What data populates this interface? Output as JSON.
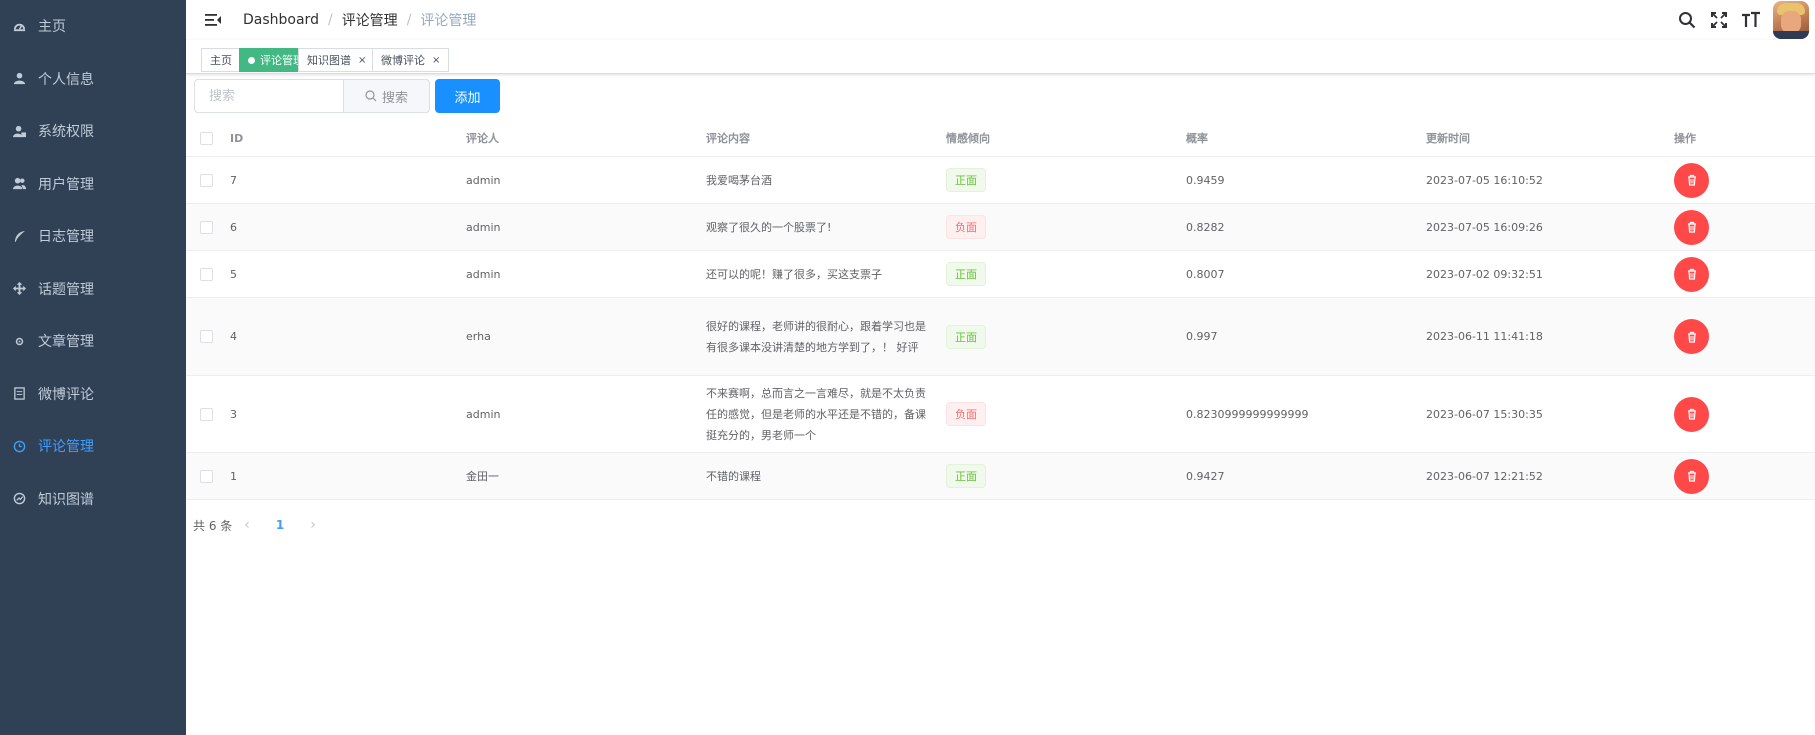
{
  "sidebar": {
    "items": [
      {
        "label": "主页",
        "icon": "dashboard-icon",
        "active": false
      },
      {
        "label": "个人信息",
        "icon": "user-icon",
        "active": false
      },
      {
        "label": "系统权限",
        "icon": "user-lock-icon",
        "active": false
      },
      {
        "label": "用户管理",
        "icon": "users-icon",
        "active": false
      },
      {
        "label": "日志管理",
        "icon": "feather-icon",
        "active": false
      },
      {
        "label": "话题管理",
        "icon": "move-icon",
        "active": false
      },
      {
        "label": "文章管理",
        "icon": "settings-icon",
        "active": false
      },
      {
        "label": "微博评论",
        "icon": "document-icon",
        "active": false
      },
      {
        "label": "评论管理",
        "icon": "clock-icon",
        "active": true
      },
      {
        "label": "知识图谱",
        "icon": "chart-icon",
        "active": false
      }
    ]
  },
  "navbar": {
    "breadcrumb": [
      "Dashboard",
      "评论管理",
      "评论管理"
    ],
    "separator": "/"
  },
  "tags": [
    {
      "label": "主页",
      "active": false,
      "closable": false
    },
    {
      "label": "评论管理",
      "active": true,
      "closable": true
    },
    {
      "label": "知识图谱",
      "active": false,
      "closable": true
    },
    {
      "label": "微博评论",
      "active": false,
      "closable": true
    }
  ],
  "tag_close": "×",
  "toolbar": {
    "search_placeholder": "搜索",
    "search_value": "",
    "search_button": "搜索",
    "add_button": "添加"
  },
  "table": {
    "headers": {
      "id": "ID",
      "user": "评论人",
      "content": "评论内容",
      "sentiment": "情感倾向",
      "probability": "概率",
      "updated": "更新时间",
      "operation": "操作"
    },
    "rows": [
      {
        "id": "7",
        "user": "admin",
        "content": "我爱喝茅台酒",
        "sentiment": "正面",
        "sentiment_type": "pos",
        "probability": "0.9459",
        "updated": "2023-07-05 16:10:52"
      },
      {
        "id": "6",
        "user": "admin",
        "content": "观察了很久的一个股票了!",
        "sentiment": "负面",
        "sentiment_type": "neg",
        "probability": "0.8282",
        "updated": "2023-07-05 16:09:26"
      },
      {
        "id": "5",
        "user": "admin",
        "content": "还可以的呢！赚了很多，买这支票子",
        "sentiment": "正面",
        "sentiment_type": "pos",
        "probability": "0.8007",
        "updated": "2023-07-02 09:32:51"
      },
      {
        "id": "4",
        "user": "erha",
        "content": "很好的课程，老师讲的很耐心，跟着学习也是有很多课本没讲清楚的地方学到了，！ 好评",
        "sentiment": "正面",
        "sentiment_type": "pos",
        "probability": "0.997",
        "updated": "2023-06-11 11:41:18"
      },
      {
        "id": "3",
        "user": "admin",
        "content": "不来赛啊，总而言之一言难尽，就是不太负责任的感觉，但是老师的水平还是不错的，备课挺充分的，男老师一个",
        "sentiment": "负面",
        "sentiment_type": "neg",
        "probability": "0.8230999999999999",
        "updated": "2023-06-07 15:30:35"
      },
      {
        "id": "1",
        "user": "金田一",
        "content": "不错的课程",
        "sentiment": "正面",
        "sentiment_type": "pos",
        "probability": "0.9427",
        "updated": "2023-06-07 12:21:52"
      }
    ]
  },
  "pagination": {
    "total_text": "共 6 条",
    "prev": "‹",
    "next": "›",
    "current_page": "1"
  },
  "colors": {
    "sidebar_bg": "#304156",
    "accent": "#409eff",
    "tag_active": "#42b983",
    "add_button": "#1890ff",
    "delete_button": "#ff4949"
  }
}
